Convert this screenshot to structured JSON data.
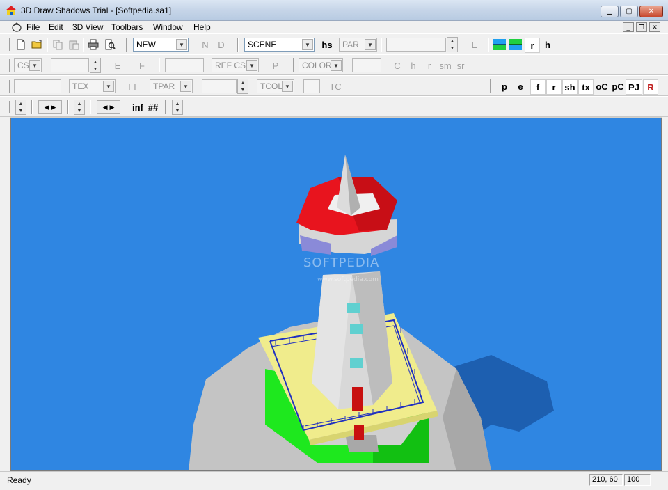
{
  "window": {
    "title": "3D Draw Shadows Trial - [Softpedia.sa1]"
  },
  "menu": [
    "File",
    "Edit",
    "3D View",
    "Toolbars",
    "Window",
    "Help"
  ],
  "toolbar1": {
    "new_combo": "NEW",
    "n": "N",
    "d": "D",
    "scene_combo": "SCENE",
    "hs": "hs",
    "par_combo": "PAR",
    "e": "E",
    "r": "r",
    "h": "h"
  },
  "toolbar2": {
    "cs_combo": "CS",
    "e": "E",
    "f": "F",
    "refcs_combo": "REF CS",
    "p": "P",
    "color_combo": "COLOR",
    "c": "C",
    "h": "h",
    "r": "r",
    "sm": "sm",
    "sr": "sr"
  },
  "toolbar3": {
    "tex_combo": "TEX",
    "tt": "TT",
    "tpar_combo": "TPAR",
    "tcol_combo": "TCOL",
    "tc": "TC",
    "modes": [
      "p",
      "e",
      "f",
      "r",
      "sh",
      "tx",
      "oC",
      "pC",
      "PJ",
      "R"
    ]
  },
  "toolbar4": {
    "inf": "inf",
    "hash": "##"
  },
  "watermark": {
    "main": "SOFTPEDIA",
    "sub": "www.softpedia.com"
  },
  "status": {
    "text": "Ready",
    "coords": "210, 60",
    "zoom": "100"
  },
  "colors": {
    "sky": "#2f86e2",
    "roof": "#e8141e",
    "platform": "#f0ec8c",
    "base": "#1ee81e",
    "rock": "#c4c4c4",
    "tower": "#d8d8d8"
  }
}
